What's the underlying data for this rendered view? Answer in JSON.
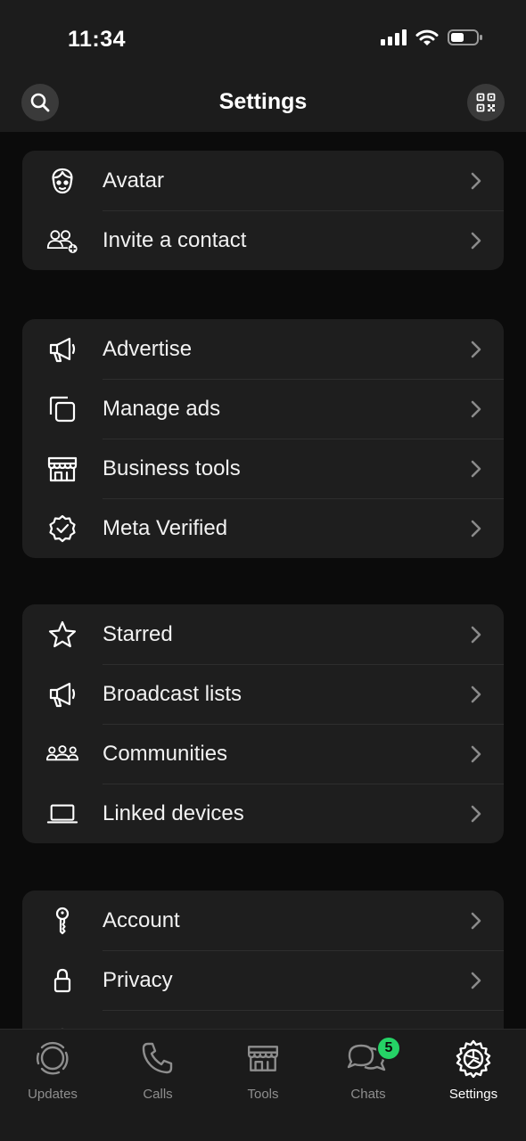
{
  "status_bar": {
    "time": "11:34",
    "icons": [
      "cellular-signal-icon",
      "wifi-icon",
      "battery-icon"
    ]
  },
  "header": {
    "title": "Settings",
    "left_icon": "search-icon",
    "right_icon": "qr-code-icon"
  },
  "groups": [
    {
      "items": [
        {
          "label": "Avatar",
          "icon": "avatar-icon"
        },
        {
          "label": "Invite a contact",
          "icon": "invite-contact-icon"
        }
      ]
    },
    {
      "items": [
        {
          "label": "Advertise",
          "icon": "megaphone-icon"
        },
        {
          "label": "Manage ads",
          "icon": "manage-ads-icon"
        },
        {
          "label": "Business tools",
          "icon": "storefront-icon"
        },
        {
          "label": "Meta Verified",
          "icon": "verified-badge-icon"
        }
      ]
    },
    {
      "items": [
        {
          "label": "Starred",
          "icon": "star-icon"
        },
        {
          "label": "Broadcast lists",
          "icon": "megaphone-icon"
        },
        {
          "label": "Communities",
          "icon": "communities-icon"
        },
        {
          "label": "Linked devices",
          "icon": "laptop-icon"
        }
      ]
    },
    {
      "items": [
        {
          "label": "Account",
          "icon": "key-icon"
        },
        {
          "label": "Privacy",
          "icon": "lock-icon"
        }
      ]
    }
  ],
  "tabs": [
    {
      "label": "Updates",
      "icon": "updates-icon",
      "active": false
    },
    {
      "label": "Calls",
      "icon": "phone-icon",
      "active": false
    },
    {
      "label": "Tools",
      "icon": "storefront-icon",
      "active": false
    },
    {
      "label": "Chats",
      "icon": "chats-icon",
      "active": false,
      "badge": "5"
    },
    {
      "label": "Settings",
      "icon": "settings-gear-icon",
      "active": true
    }
  ],
  "colors": {
    "accent_badge": "#25d366",
    "card_bg": "#1e1e1e",
    "page_bg": "#0b0b0b"
  }
}
